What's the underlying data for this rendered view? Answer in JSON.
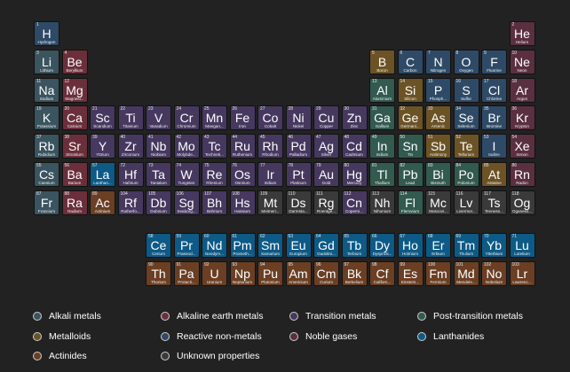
{
  "colors": {
    "alkali": "#3a5460",
    "alkaline": "#6b2f3c",
    "transition": "#46385f",
    "post_transition": "#325a4e",
    "metalloid": "#6c5326",
    "nonmetal": "#2e4a66",
    "noble": "#5a2f40",
    "lanthanide": "#0d5a86",
    "actinide": "#6a3f24",
    "unknown": "#3a3a3a"
  },
  "elements": [
    {
      "n": 1,
      "s": "H",
      "name": "Hydrogen",
      "c": "nonmetal",
      "p": 1,
      "g": 1
    },
    {
      "n": 2,
      "s": "He",
      "name": "Helium",
      "c": "noble",
      "p": 1,
      "g": 18
    },
    {
      "n": 3,
      "s": "Li",
      "name": "Lithium",
      "c": "alkali",
      "p": 2,
      "g": 1
    },
    {
      "n": 4,
      "s": "Be",
      "name": "Beryllium",
      "c": "alkaline",
      "p": 2,
      "g": 2
    },
    {
      "n": 5,
      "s": "B",
      "name": "Boron",
      "c": "metalloid",
      "p": 2,
      "g": 13
    },
    {
      "n": 6,
      "s": "C",
      "name": "Carbon",
      "c": "nonmetal",
      "p": 2,
      "g": 14
    },
    {
      "n": 7,
      "s": "N",
      "name": "Nitrogen",
      "c": "nonmetal",
      "p": 2,
      "g": 15
    },
    {
      "n": 8,
      "s": "O",
      "name": "Oxygen",
      "c": "nonmetal",
      "p": 2,
      "g": 16
    },
    {
      "n": 9,
      "s": "F",
      "name": "Fluorine",
      "c": "nonmetal",
      "p": 2,
      "g": 17
    },
    {
      "n": 10,
      "s": "Ne",
      "name": "Neon",
      "c": "noble",
      "p": 2,
      "g": 18
    },
    {
      "n": 11,
      "s": "Na",
      "name": "Sodium",
      "c": "alkali",
      "p": 3,
      "g": 1
    },
    {
      "n": 12,
      "s": "Mg",
      "name": "Magnesi...",
      "c": "alkaline",
      "p": 3,
      "g": 2
    },
    {
      "n": 13,
      "s": "Al",
      "name": "Aluminium",
      "c": "post_transition",
      "p": 3,
      "g": 13
    },
    {
      "n": 14,
      "s": "Si",
      "name": "Silicon",
      "c": "metalloid",
      "p": 3,
      "g": 14
    },
    {
      "n": 15,
      "s": "P",
      "name": "Phosph...",
      "c": "nonmetal",
      "p": 3,
      "g": 15
    },
    {
      "n": 16,
      "s": "S",
      "name": "Sulfur",
      "c": "nonmetal",
      "p": 3,
      "g": 16
    },
    {
      "n": 17,
      "s": "Cl",
      "name": "Chlorine",
      "c": "nonmetal",
      "p": 3,
      "g": 17
    },
    {
      "n": 18,
      "s": "Ar",
      "name": "Argon",
      "c": "noble",
      "p": 3,
      "g": 18
    },
    {
      "n": 19,
      "s": "K",
      "name": "Potassium",
      "c": "alkali",
      "p": 4,
      "g": 1
    },
    {
      "n": 20,
      "s": "Ca",
      "name": "Calcium",
      "c": "alkaline",
      "p": 4,
      "g": 2
    },
    {
      "n": 21,
      "s": "Sc",
      "name": "Scandium",
      "c": "transition",
      "p": 4,
      "g": 3
    },
    {
      "n": 22,
      "s": "Ti",
      "name": "Titanium",
      "c": "transition",
      "p": 4,
      "g": 4
    },
    {
      "n": 23,
      "s": "V",
      "name": "Vanadium",
      "c": "transition",
      "p": 4,
      "g": 5
    },
    {
      "n": 24,
      "s": "Cr",
      "name": "Chromium",
      "c": "transition",
      "p": 4,
      "g": 6
    },
    {
      "n": 25,
      "s": "Mn",
      "name": "Mangan...",
      "c": "transition",
      "p": 4,
      "g": 7
    },
    {
      "n": 26,
      "s": "Fe",
      "name": "Iron",
      "c": "transition",
      "p": 4,
      "g": 8
    },
    {
      "n": 27,
      "s": "Co",
      "name": "Cobalt",
      "c": "transition",
      "p": 4,
      "g": 9
    },
    {
      "n": 28,
      "s": "Ni",
      "name": "Nickel",
      "c": "transition",
      "p": 4,
      "g": 10
    },
    {
      "n": 29,
      "s": "Cu",
      "name": "Copper",
      "c": "transition",
      "p": 4,
      "g": 11
    },
    {
      "n": 30,
      "s": "Zn",
      "name": "Zinc",
      "c": "transition",
      "p": 4,
      "g": 12
    },
    {
      "n": 31,
      "s": "Ga",
      "name": "Gallium",
      "c": "post_transition",
      "p": 4,
      "g": 13
    },
    {
      "n": 32,
      "s": "Ge",
      "name": "Germani...",
      "c": "metalloid",
      "p": 4,
      "g": 14
    },
    {
      "n": 33,
      "s": "As",
      "name": "Arsenic",
      "c": "metalloid",
      "p": 4,
      "g": 15
    },
    {
      "n": 34,
      "s": "Se",
      "name": "Selenium",
      "c": "nonmetal",
      "p": 4,
      "g": 16
    },
    {
      "n": 35,
      "s": "Br",
      "name": "Bromine",
      "c": "nonmetal",
      "p": 4,
      "g": 17
    },
    {
      "n": 36,
      "s": "Kr",
      "name": "Krypton",
      "c": "noble",
      "p": 4,
      "g": 18
    },
    {
      "n": 37,
      "s": "Rb",
      "name": "Rubidium",
      "c": "alkali",
      "p": 5,
      "g": 1
    },
    {
      "n": 38,
      "s": "Sr",
      "name": "Strontium",
      "c": "alkaline",
      "p": 5,
      "g": 2
    },
    {
      "n": 39,
      "s": "Y",
      "name": "Yttrium",
      "c": "transition",
      "p": 5,
      "g": 3
    },
    {
      "n": 40,
      "s": "Zr",
      "name": "Zirconium",
      "c": "transition",
      "p": 5,
      "g": 4
    },
    {
      "n": 41,
      "s": "Nb",
      "name": "Niobium",
      "c": "transition",
      "p": 5,
      "g": 5
    },
    {
      "n": 42,
      "s": "Mo",
      "name": "Molybde...",
      "c": "transition",
      "p": 5,
      "g": 6
    },
    {
      "n": 43,
      "s": "Tc",
      "name": "Techneti...",
      "c": "transition",
      "p": 5,
      "g": 7
    },
    {
      "n": 44,
      "s": "Ru",
      "name": "Ruthenium",
      "c": "transition",
      "p": 5,
      "g": 8
    },
    {
      "n": 45,
      "s": "Rh",
      "name": "Rhodium",
      "c": "transition",
      "p": 5,
      "g": 9
    },
    {
      "n": 46,
      "s": "Pd",
      "name": "Palladium",
      "c": "transition",
      "p": 5,
      "g": 10
    },
    {
      "n": 47,
      "s": "Ag",
      "name": "Silver",
      "c": "transition",
      "p": 5,
      "g": 11
    },
    {
      "n": 48,
      "s": "Cd",
      "name": "Cadmium",
      "c": "transition",
      "p": 5,
      "g": 12
    },
    {
      "n": 49,
      "s": "In",
      "name": "Indium",
      "c": "post_transition",
      "p": 5,
      "g": 13
    },
    {
      "n": 50,
      "s": "Sn",
      "name": "Tin",
      "c": "post_transition",
      "p": 5,
      "g": 14
    },
    {
      "n": 51,
      "s": "Sb",
      "name": "Antimony",
      "c": "metalloid",
      "p": 5,
      "g": 15
    },
    {
      "n": 52,
      "s": "Te",
      "name": "Tellurium",
      "c": "metalloid",
      "p": 5,
      "g": 16
    },
    {
      "n": 53,
      "s": "I",
      "name": "Iodine",
      "c": "nonmetal",
      "p": 5,
      "g": 17
    },
    {
      "n": 54,
      "s": "Xe",
      "name": "Xenon",
      "c": "noble",
      "p": 5,
      "g": 18
    },
    {
      "n": 55,
      "s": "Cs",
      "name": "Caesium",
      "c": "alkali",
      "p": 6,
      "g": 1
    },
    {
      "n": 56,
      "s": "Ba",
      "name": "Barium",
      "c": "alkaline",
      "p": 6,
      "g": 2
    },
    {
      "n": 57,
      "s": "La",
      "name": "Lanthan...",
      "c": "lanthanide",
      "p": 6,
      "g": 3
    },
    {
      "n": 72,
      "s": "Hf",
      "name": "Hafnium",
      "c": "transition",
      "p": 6,
      "g": 4
    },
    {
      "n": 73,
      "s": "Ta",
      "name": "Tantalum",
      "c": "transition",
      "p": 6,
      "g": 5
    },
    {
      "n": 74,
      "s": "W",
      "name": "Tungsten",
      "c": "transition",
      "p": 6,
      "g": 6
    },
    {
      "n": 75,
      "s": "Re",
      "name": "Rhenium",
      "c": "transition",
      "p": 6,
      "g": 7
    },
    {
      "n": 76,
      "s": "Os",
      "name": "Osmium",
      "c": "transition",
      "p": 6,
      "g": 8
    },
    {
      "n": 77,
      "s": "Ir",
      "name": "Iridium",
      "c": "transition",
      "p": 6,
      "g": 9
    },
    {
      "n": 78,
      "s": "Pt",
      "name": "Platinum",
      "c": "transition",
      "p": 6,
      "g": 10
    },
    {
      "n": 79,
      "s": "Au",
      "name": "Gold",
      "c": "transition",
      "p": 6,
      "g": 11
    },
    {
      "n": 80,
      "s": "Hg",
      "name": "Mercury",
      "c": "transition",
      "p": 6,
      "g": 12
    },
    {
      "n": 81,
      "s": "Tl",
      "name": "Thallium",
      "c": "post_transition",
      "p": 6,
      "g": 13
    },
    {
      "n": 82,
      "s": "Pb",
      "name": "Lead",
      "c": "post_transition",
      "p": 6,
      "g": 14
    },
    {
      "n": 83,
      "s": "Bi",
      "name": "Bismuth",
      "c": "post_transition",
      "p": 6,
      "g": 15
    },
    {
      "n": 84,
      "s": "Po",
      "name": "Polonium",
      "c": "post_transition",
      "p": 6,
      "g": 16
    },
    {
      "n": 85,
      "s": "At",
      "name": "Astatine",
      "c": "metalloid",
      "p": 6,
      "g": 17
    },
    {
      "n": 86,
      "s": "Rn",
      "name": "Radon",
      "c": "noble",
      "p": 6,
      "g": 18
    },
    {
      "n": 87,
      "s": "Fr",
      "name": "Francium",
      "c": "alkali",
      "p": 7,
      "g": 1
    },
    {
      "n": 88,
      "s": "Ra",
      "name": "Radium",
      "c": "alkaline",
      "p": 7,
      "g": 2
    },
    {
      "n": 89,
      "s": "Ac",
      "name": "Actinium",
      "c": "actinide",
      "p": 7,
      "g": 3
    },
    {
      "n": 104,
      "s": "Rf",
      "name": "Rutherfo...",
      "c": "transition",
      "p": 7,
      "g": 4
    },
    {
      "n": 105,
      "s": "Db",
      "name": "Dubnium",
      "c": "transition",
      "p": 7,
      "g": 5
    },
    {
      "n": 106,
      "s": "Sg",
      "name": "Seaborg...",
      "c": "transition",
      "p": 7,
      "g": 6
    },
    {
      "n": 107,
      "s": "Bh",
      "name": "Bohrium",
      "c": "transition",
      "p": 7,
      "g": 7
    },
    {
      "n": 108,
      "s": "Hs",
      "name": "Hassium",
      "c": "transition",
      "p": 7,
      "g": 8
    },
    {
      "n": 109,
      "s": "Mt",
      "name": "Meitneri...",
      "c": "unknown",
      "p": 7,
      "g": 9
    },
    {
      "n": 110,
      "s": "Ds",
      "name": "Darmsta...",
      "c": "unknown",
      "p": 7,
      "g": 10
    },
    {
      "n": 111,
      "s": "Rg",
      "name": "Roentge...",
      "c": "unknown",
      "p": 7,
      "g": 11
    },
    {
      "n": 112,
      "s": "Cn",
      "name": "Coperni...",
      "c": "transition",
      "p": 7,
      "g": 12
    },
    {
      "n": 113,
      "s": "Nh",
      "name": "Nihonium",
      "c": "unknown",
      "p": 7,
      "g": 13
    },
    {
      "n": 114,
      "s": "Fl",
      "name": "Flerovium",
      "c": "post_transition",
      "p": 7,
      "g": 14
    },
    {
      "n": 115,
      "s": "Mc",
      "name": "Moscovi...",
      "c": "unknown",
      "p": 7,
      "g": 15
    },
    {
      "n": 116,
      "s": "Lv",
      "name": "Livermor...",
      "c": "unknown",
      "p": 7,
      "g": 16
    },
    {
      "n": 117,
      "s": "Ts",
      "name": "Tenness...",
      "c": "unknown",
      "p": 7,
      "g": 17
    },
    {
      "n": 118,
      "s": "Og",
      "name": "Oganess...",
      "c": "unknown",
      "p": 7,
      "g": 18
    },
    {
      "n": 58,
      "s": "Ce",
      "name": "Cerium",
      "c": "lanthanide",
      "p": 9,
      "g": 5
    },
    {
      "n": 59,
      "s": "Pr",
      "name": "Praseod...",
      "c": "lanthanide",
      "p": 9,
      "g": 6
    },
    {
      "n": 60,
      "s": "Nd",
      "name": "Neodym...",
      "c": "lanthanide",
      "p": 9,
      "g": 7
    },
    {
      "n": 61,
      "s": "Pm",
      "name": "Prometh...",
      "c": "lanthanide",
      "p": 9,
      "g": 8
    },
    {
      "n": 62,
      "s": "Sm",
      "name": "Samarium",
      "c": "lanthanide",
      "p": 9,
      "g": 9
    },
    {
      "n": 63,
      "s": "Eu",
      "name": "Europium",
      "c": "lanthanide",
      "p": 9,
      "g": 10
    },
    {
      "n": 64,
      "s": "Gd",
      "name": "Gadolini...",
      "c": "lanthanide",
      "p": 9,
      "g": 11
    },
    {
      "n": 65,
      "s": "Tb",
      "name": "Terbium",
      "c": "lanthanide",
      "p": 9,
      "g": 12
    },
    {
      "n": 66,
      "s": "Dy",
      "name": "Dysprosi...",
      "c": "lanthanide",
      "p": 9,
      "g": 13
    },
    {
      "n": 67,
      "s": "Ho",
      "name": "Holmium",
      "c": "lanthanide",
      "p": 9,
      "g": 14
    },
    {
      "n": 68,
      "s": "Er",
      "name": "Erbium",
      "c": "lanthanide",
      "p": 9,
      "g": 15
    },
    {
      "n": 69,
      "s": "Tm",
      "name": "Thulium",
      "c": "lanthanide",
      "p": 9,
      "g": 16
    },
    {
      "n": 70,
      "s": "Yb",
      "name": "Ytterbium",
      "c": "lanthanide",
      "p": 9,
      "g": 17
    },
    {
      "n": 71,
      "s": "Lu",
      "name": "Lutetium",
      "c": "lanthanide",
      "p": 9,
      "g": 18
    },
    {
      "n": 90,
      "s": "Th",
      "name": "Thorium",
      "c": "actinide",
      "p": 10,
      "g": 5
    },
    {
      "n": 91,
      "s": "Pa",
      "name": "Protacti...",
      "c": "actinide",
      "p": 10,
      "g": 6
    },
    {
      "n": 92,
      "s": "U",
      "name": "Uranium",
      "c": "actinide",
      "p": 10,
      "g": 7
    },
    {
      "n": 93,
      "s": "Np",
      "name": "Neptunium",
      "c": "actinide",
      "p": 10,
      "g": 8
    },
    {
      "n": 94,
      "s": "Pu",
      "name": "Plutonium",
      "c": "actinide",
      "p": 10,
      "g": 9
    },
    {
      "n": 95,
      "s": "Am",
      "name": "Americium",
      "c": "actinide",
      "p": 10,
      "g": 10
    },
    {
      "n": 96,
      "s": "Cm",
      "name": "Curium",
      "c": "actinide",
      "p": 10,
      "g": 11
    },
    {
      "n": 97,
      "s": "Bk",
      "name": "Berkelium",
      "c": "actinide",
      "p": 10,
      "g": 12
    },
    {
      "n": 98,
      "s": "Cf",
      "name": "Californ...",
      "c": "actinide",
      "p": 10,
      "g": 13
    },
    {
      "n": 99,
      "s": "Es",
      "name": "Einstein...",
      "c": "actinide",
      "p": 10,
      "g": 14
    },
    {
      "n": 100,
      "s": "Fm",
      "name": "Fermium",
      "c": "actinide",
      "p": 10,
      "g": 15
    },
    {
      "n": 101,
      "s": "Md",
      "name": "Mendele...",
      "c": "actinide",
      "p": 10,
      "g": 16
    },
    {
      "n": 102,
      "s": "No",
      "name": "Nobelium",
      "c": "actinide",
      "p": 10,
      "g": 17
    },
    {
      "n": 103,
      "s": "Lr",
      "name": "Lawrenc...",
      "c": "actinide",
      "p": 10,
      "g": 18
    }
  ],
  "legend": [
    {
      "label": "Alkali metals",
      "dot": "#3a5460"
    },
    {
      "label": "Alkaline earth metals",
      "dot": "#6b2f3c"
    },
    {
      "label": "Transition metals",
      "dot": "#46385f"
    },
    {
      "label": "Post-transition metals",
      "dot": "#325a4e"
    },
    {
      "label": "Metalloids",
      "dot": "#6c5326"
    },
    {
      "label": "Reactive non-metals",
      "dot": "#2e4a66"
    },
    {
      "label": "Noble gases",
      "dot": "#5a2f40"
    },
    {
      "label": "Lanthanides",
      "dot": "#0d5a86"
    },
    {
      "label": "Actinides",
      "dot": "#6a3f24"
    },
    {
      "label": "Unknown properties",
      "dot": "#3a3a3a"
    }
  ]
}
